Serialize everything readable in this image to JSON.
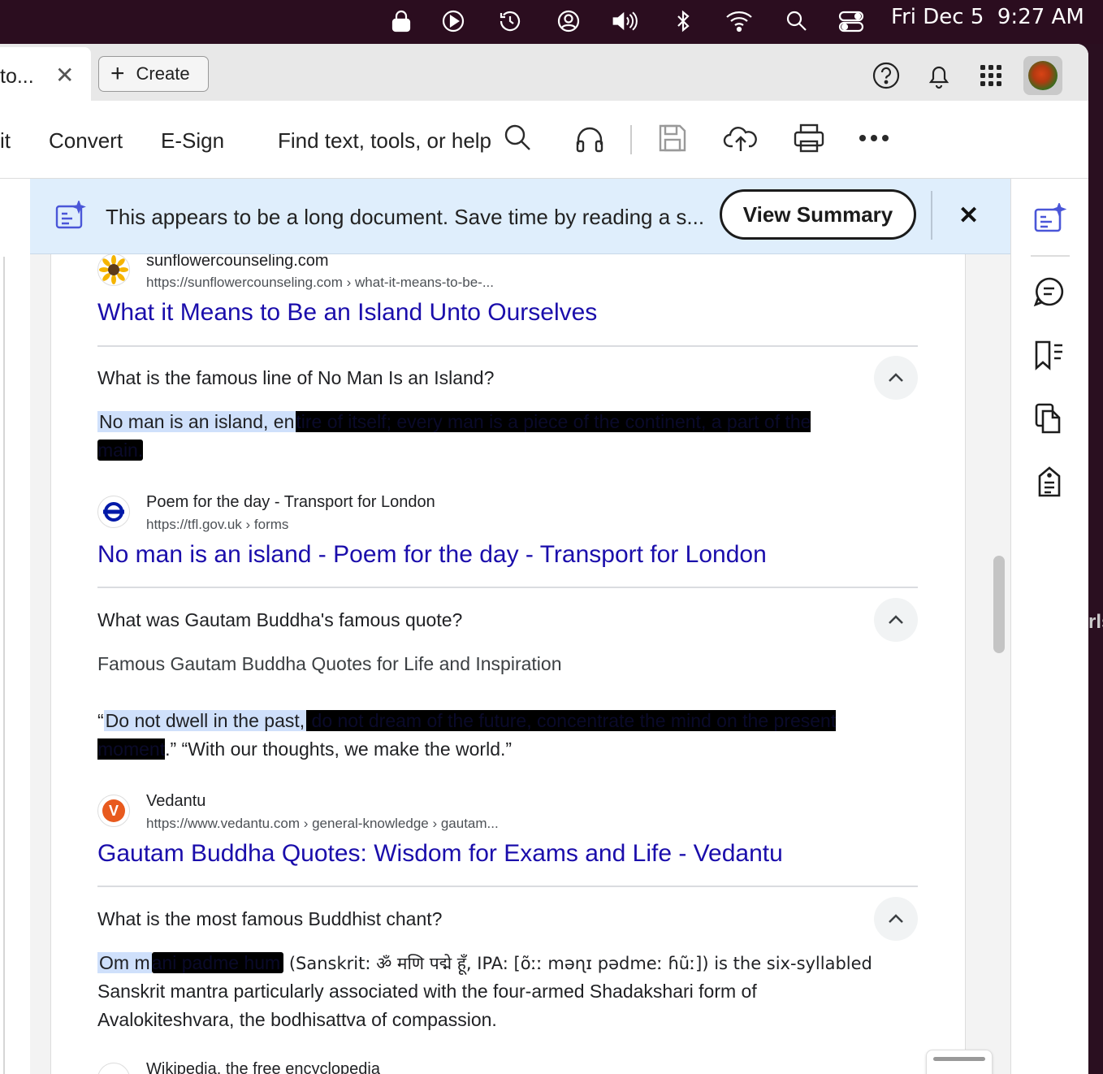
{
  "menubar": {
    "date": "Fri Dec 5",
    "time": "9:27 AM"
  },
  "tabbar": {
    "tab_title": "to...",
    "tab_close": "✕",
    "create_label": "Create"
  },
  "toolbar": {
    "edit_partial": "it",
    "convert": "Convert",
    "esign": "E-Sign",
    "search_label": "Find text, tools, or help"
  },
  "banner": {
    "message": "This appears to be a long document. Save time by reading a s...",
    "view_summary": "View Summary",
    "close": "✕"
  },
  "results": [
    {
      "site": "sunflowercounseling.com",
      "url": "https://sunflowercounseling.com › what-it-means-to-be-...",
      "title": "What it Means to Be an Island Unto Ourselves"
    },
    {
      "site": "Poem for the day - Transport for London",
      "url": "https://tfl.gov.uk › forms",
      "title": "No man is an island - Poem for the day - Transport for London"
    },
    {
      "site": "Vedantu",
      "url": "https://www.vedantu.com › general-knowledge › gautam...",
      "title": "Gautam Buddha Quotes: Wisdom for Exams and Life - Vedantu"
    },
    {
      "site": "Wikipedia, the free encyclopedia"
    }
  ],
  "questions": [
    {
      "q": "What is the famous line of No Man Is an Island?",
      "a_highlight": "No man is an island, en",
      "a_redacted1": "tire of itself; every man is a piece of the continent, a part of the",
      "a_redacted2": "main."
    },
    {
      "q": "What was Gautam Buddha's famous quote?",
      "a_line1": "Famous Gautam Buddha Quotes for Life and Inspiration",
      "a_quote_open": "“",
      "a_highlight": "Do not dwell in the past,",
      "a_redacted1": " do not dream of the future, concentrate the mind on the present",
      "a_redacted2": "moment",
      "a_tail": ".” “With our thoughts, we make the world.”"
    },
    {
      "q": "What is the most famous Buddhist chant?",
      "a_highlight": "Om m",
      "a_redacted": "ani padme hum",
      "a_rest1": " (Sanskrit: ॐ मणि पद्मे हूँ, IPA: [õːː məɳɪ pədmeː ɦũː]) is the six-syllabled",
      "a_rest2": "Sanskrit mantra particularly associated with the four-armed Shadakshari form of",
      "a_rest3": "Avalokiteshvara, the bodhisattva of compassion."
    }
  ],
  "edge_text": "rls",
  "colors": {
    "link": "#1a0dab",
    "banner_bg": "#dfeefc",
    "highlight": "#cfe0fb",
    "menubar_bg": "#2b0d1f"
  }
}
